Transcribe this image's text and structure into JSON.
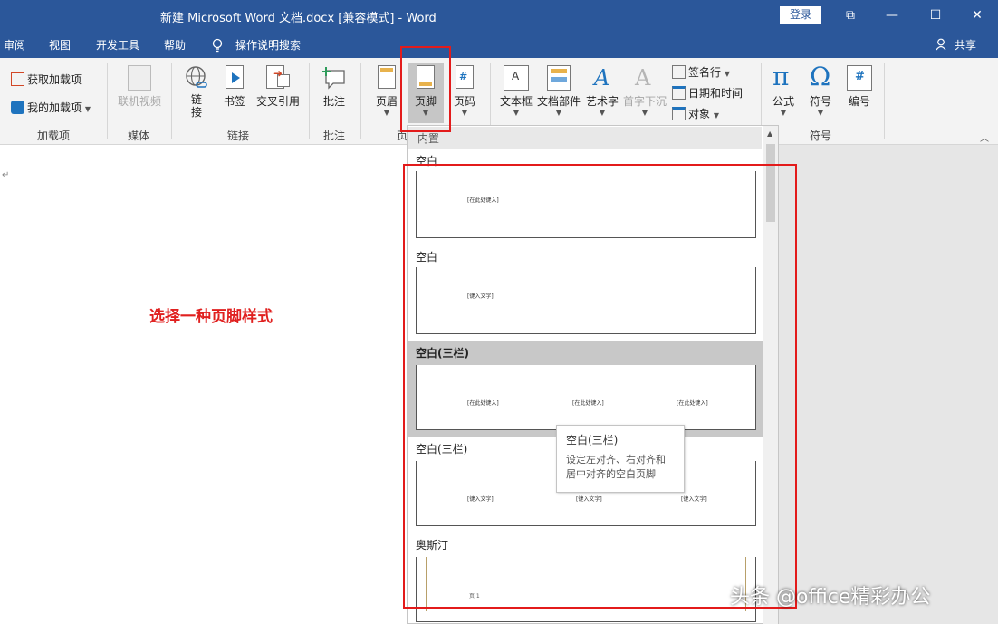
{
  "titlebar": {
    "title": "新建 Microsoft Word 文档.docx [兼容模式]  -  Word",
    "login_label": "登录",
    "restore_glyph": "⧉",
    "min_glyph": "—",
    "max_glyph": "☐",
    "close_glyph": "✕"
  },
  "menu": {
    "tabs": [
      "审阅",
      "视图",
      "开发工具",
      "帮助"
    ],
    "search_label": "操作说明搜索",
    "share_label": "共享"
  },
  "ribbon": {
    "addins": {
      "get_label": "获取加载项",
      "my_label": "我的加载项",
      "group_label": "加载项"
    },
    "media": {
      "online_video_label": "联机视频",
      "group_label": "媒体"
    },
    "links": {
      "link_label": "链\n接",
      "bookmark_label": "书签",
      "crossref_label": "交叉引用",
      "group_label": "链接"
    },
    "comments": {
      "comment_label": "批注",
      "group_label": "批注"
    },
    "headerfooter": {
      "header_label": "页眉",
      "footer_label": "页脚",
      "pagenum_label": "页码",
      "group_label": "页"
    },
    "text": {
      "textbox_label": "文本框",
      "quickparts_label": "文档部件",
      "wordart_label": "艺术字",
      "dropcap_label": "首字下沉",
      "signature_label": "签名行",
      "datetime_label": "日期和时间",
      "object_label": "对象"
    },
    "symbols": {
      "equation_label": "公式",
      "symbol_label": "符号",
      "number_label": "编号",
      "group_label": "符号"
    }
  },
  "document": {
    "annotation": "选择一种页脚样式"
  },
  "gallery": {
    "section_title": "内置",
    "items": [
      {
        "name": "空白",
        "placeholders": [
          "[在此处键入]"
        ]
      },
      {
        "name": "空白",
        "placeholders": [
          "[键入文字]"
        ]
      },
      {
        "name": "空白(三栏)",
        "placeholders": [
          "[在此处键入]",
          "[在此处键入]",
          "[在此处键入]"
        ]
      },
      {
        "name": "空白(三栏)",
        "placeholders": [
          "[键入文字]",
          "[键入文字]",
          "[键入文字]"
        ]
      },
      {
        "name": "奥斯汀",
        "placeholders": [
          "页 1"
        ]
      }
    ]
  },
  "tooltip": {
    "title": "空白(三栏)",
    "description": "设定左对齐、右对齐和居中对齐的空白页脚"
  },
  "watermark": "头条 @office精彩办公",
  "colors": {
    "brand": "#2b579a",
    "annotation_red": "#e31b1b",
    "highlight": "#c8c8c8"
  }
}
